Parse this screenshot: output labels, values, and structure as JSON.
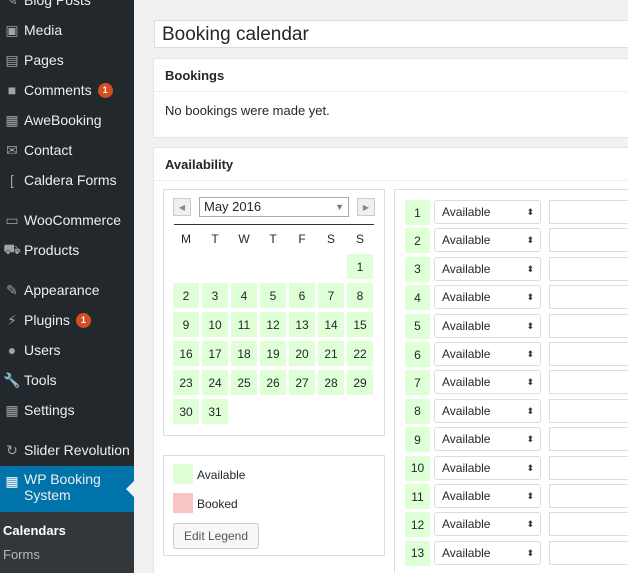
{
  "sidebar": {
    "items": [
      {
        "label": "Blog Posts",
        "icon": "pin-icon",
        "badge": ""
      },
      {
        "label": "Media",
        "icon": "media-icon",
        "badge": ""
      },
      {
        "label": "Pages",
        "icon": "pages-icon",
        "badge": ""
      },
      {
        "label": "Comments",
        "icon": "comments-icon",
        "badge": "1"
      },
      {
        "label": "AweBooking",
        "icon": "calendar-grid-icon",
        "badge": ""
      },
      {
        "label": "Contact",
        "icon": "envelope-icon",
        "badge": ""
      },
      {
        "label": "Caldera Forms",
        "icon": "caldera-icon",
        "badge": ""
      },
      {
        "label": "WooCommerce",
        "icon": "woocommerce-icon",
        "badge": ""
      },
      {
        "label": "Products",
        "icon": "cart-icon",
        "badge": ""
      },
      {
        "label": "Appearance",
        "icon": "brush-icon",
        "badge": ""
      },
      {
        "label": "Plugins",
        "icon": "plug-icon",
        "badge": "1"
      },
      {
        "label": "Users",
        "icon": "user-icon",
        "badge": ""
      },
      {
        "label": "Tools",
        "icon": "wrench-icon",
        "badge": ""
      },
      {
        "label": "Settings",
        "icon": "settings-icon",
        "badge": ""
      },
      {
        "label": "Slider Revolution",
        "icon": "refresh-icon",
        "badge": ""
      },
      {
        "label": "WP Booking System",
        "icon": "calendar-icon",
        "badge": ""
      }
    ],
    "submenu": [
      {
        "label": "Calendars"
      },
      {
        "label": "Forms"
      }
    ]
  },
  "main": {
    "title_value": "Booking calendar",
    "bookings": {
      "heading": "Bookings",
      "message": "No bookings were made yet."
    },
    "availability": {
      "heading": "Availability"
    }
  },
  "calendar": {
    "month_selected": "May 2016",
    "prev_icon": "triangle-left-icon",
    "next_icon": "triangle-right-icon",
    "weekdays": [
      "M",
      "T",
      "W",
      "T",
      "F",
      "S",
      "S"
    ],
    "first_weekday_index": 6,
    "days": [
      1,
      2,
      3,
      4,
      5,
      6,
      7,
      8,
      9,
      10,
      11,
      12,
      13,
      14,
      15,
      16,
      17,
      18,
      19,
      20,
      21,
      22,
      23,
      24,
      25,
      26,
      27,
      28,
      29,
      30,
      31
    ]
  },
  "legend": {
    "items": [
      {
        "label": "Available",
        "color": "#dfffd6"
      },
      {
        "label": "Booked",
        "color": "#f7c5c5"
      }
    ],
    "edit_label": "Edit Legend"
  },
  "availability_rows": [
    {
      "day": "1",
      "status": "Available"
    },
    {
      "day": "2",
      "status": "Available"
    },
    {
      "day": "3",
      "status": "Available"
    },
    {
      "day": "4",
      "status": "Available"
    },
    {
      "day": "5",
      "status": "Available"
    },
    {
      "day": "6",
      "status": "Available"
    },
    {
      "day": "7",
      "status": "Available"
    },
    {
      "day": "8",
      "status": "Available"
    },
    {
      "day": "9",
      "status": "Available"
    },
    {
      "day": "10",
      "status": "Available"
    },
    {
      "day": "11",
      "status": "Available"
    },
    {
      "day": "12",
      "status": "Available"
    },
    {
      "day": "13",
      "status": "Available"
    }
  ],
  "colors": {
    "sidebar_bg": "#23282d",
    "active_bg": "#0073aa",
    "available": "#dfffd6",
    "booked": "#f7c5c5",
    "badge": "#d54e21"
  }
}
